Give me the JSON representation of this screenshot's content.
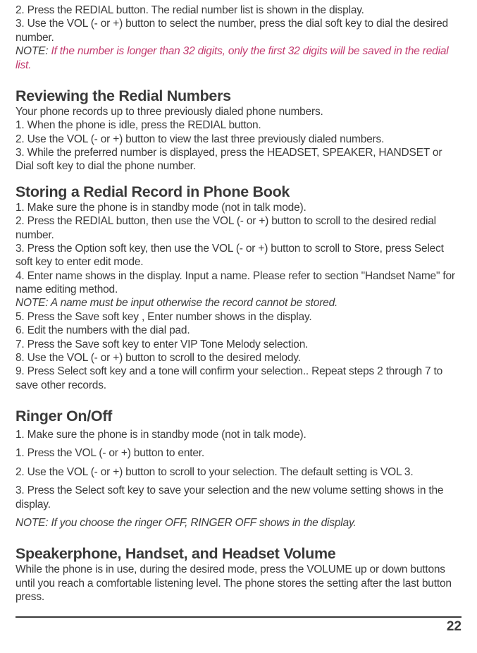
{
  "intro": {
    "line1": "2.  Press the REDIAL button. The redial number list is shown in the display.",
    "line2": "3. Use the VOL (- or +) button to select the number, press the dial soft key to dial the desired number.",
    "note_label": "NOTE: ",
    "note_red": "If the number is longer than 32 digits, only the first 32 digits will be saved in the redial list."
  },
  "section1": {
    "heading": "Reviewing the Redial Numbers",
    "p1": "Your phone records up to three previously dialed phone numbers.",
    "p2": "1. When the phone is idle, press the REDIAL button.",
    "p3": "2. Use the VOL (- or +) button to view the last three previously dialed numbers.",
    "p4": "3. While the preferred number is displayed, press the HEADSET, SPEAKER, HANDSET or Dial soft key to dial the phone number."
  },
  "section2": {
    "heading": "Storing a Redial Record in Phone Book",
    "p1": "1. Make sure the phone is in standby mode (not in talk mode).",
    "p2": "2. Press the REDIAL button, then use the VOL (- or +) button to scroll to the desired redial number.",
    "p3": "3. Press the Option soft key, then use the VOL (- or +) button to scroll to Store, press Select soft key to enter edit mode.",
    "p4": "4. Enter name shows in the display. Input a name. Please refer to section \"Handset Name\" for name editing method.",
    "note": "NOTE: A name must be input otherwise the record cannot be stored.",
    "p5": "5. Press the Save soft key , Enter number shows in the display.",
    "p6": "6. Edit the numbers with the dial pad.",
    "p7": "7. Press the Save soft key to enter VIP Tone Melody selection.",
    "p8": "8. Use the VOL (- or +) button to scroll to the desired melody.",
    "p9": "9. Press Select soft key and a tone will confirm your selection.. Repeat steps 2 through 7 to save other records."
  },
  "section3": {
    "heading": "Ringer On/Off",
    "p1": "1. Make sure the phone is in standby mode (not in talk mode).",
    "p2": "1. Press the VOL (- or +) button to enter.",
    "p3": "2. Use the VOL (- or +) button to scroll to your selection. The default setting is VOL 3.",
    "p4": "3. Press the Select soft key to save your selection and the new volume setting shows in the display.",
    "note": "NOTE: If you choose the ringer OFF, RINGER OFF shows in the display."
  },
  "section4": {
    "heading": "Speakerphone, Handset, and Headset Volume",
    "p1": "While the phone is in use, during the desired mode, press the VOLUME up or down buttons until you reach a comfortable listening level. The phone stores the setting after the last button press."
  },
  "page_number": "22"
}
